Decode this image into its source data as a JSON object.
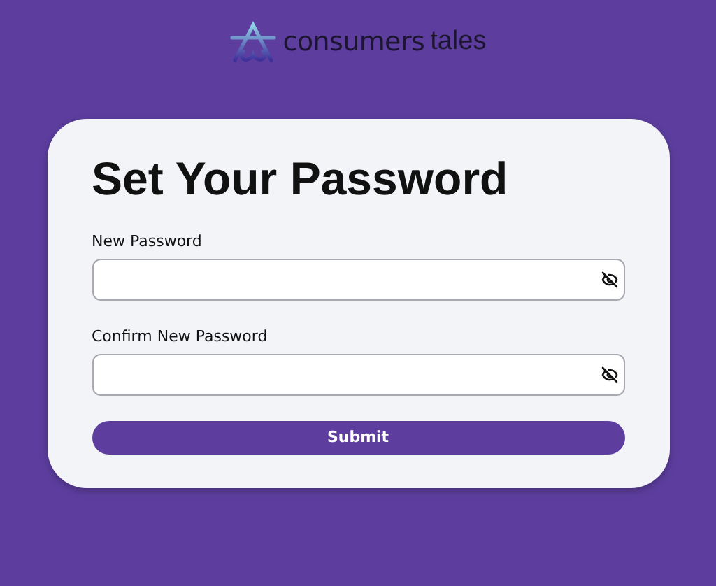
{
  "logo": {
    "name_bold": "consumers",
    "name_light": "tales"
  },
  "title": "Set Your Password",
  "fields": [
    {
      "label": "New Password",
      "visible": false
    },
    {
      "label": "Confirm New Password",
      "visible": false
    }
  ],
  "submit": "Submit"
}
